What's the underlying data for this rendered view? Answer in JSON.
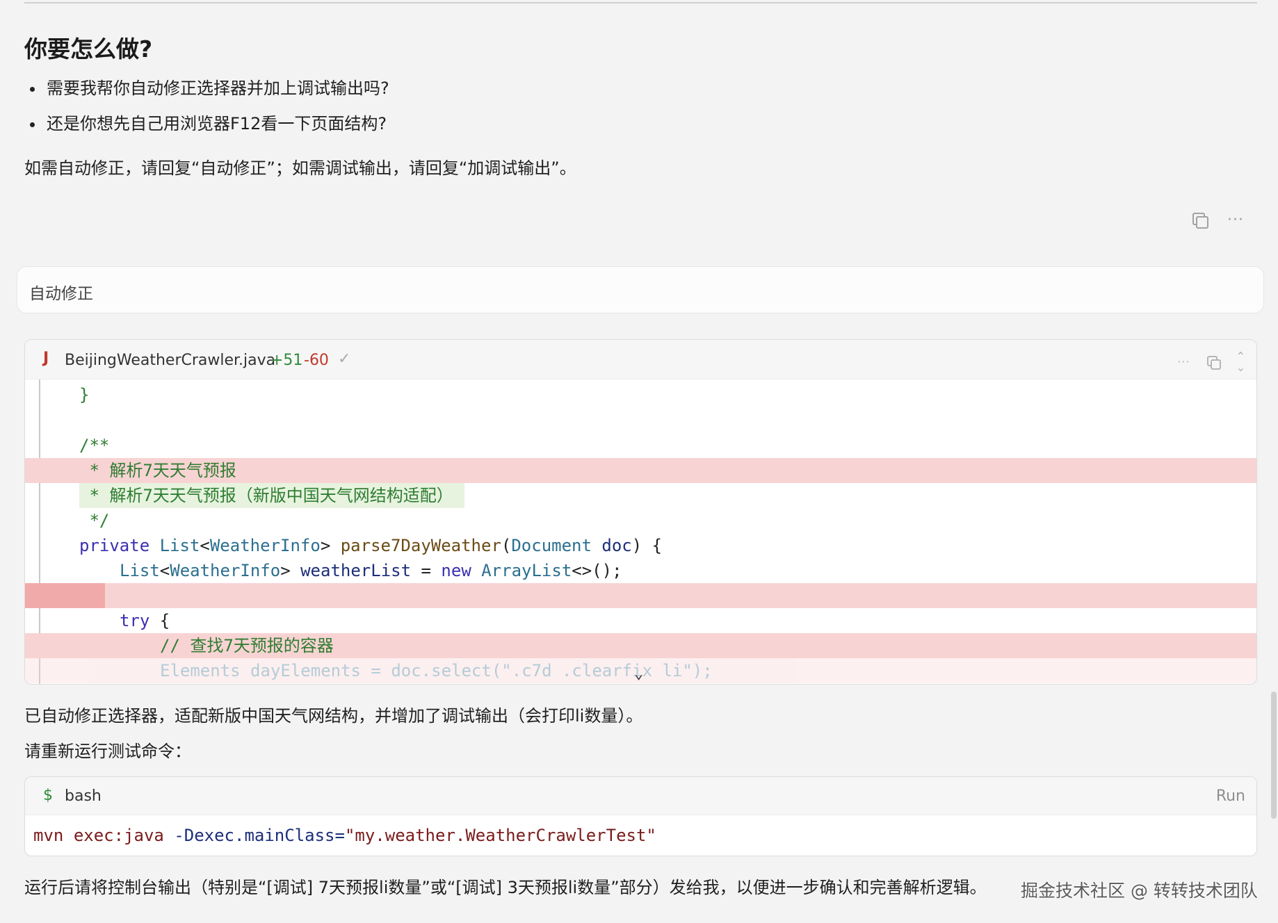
{
  "assistant_msg1": {
    "heading": "你要怎么做?",
    "bullets": [
      "需要我帮你自动修正选择器并加上调试输出吗?",
      "还是你想先自己用浏览器F12看一下页面结构?"
    ],
    "instruction": "如需自动修正，请回复“自动修正”；如需调试输出，请回复“加调试输出”。",
    "copy_icon": "copy-icon",
    "more_icon": "ellipsis-icon"
  },
  "user_msg": {
    "text": "自动修正"
  },
  "code_diff": {
    "file_icon": "J",
    "file_name": "BeijingWeatherCrawler.java",
    "additions": "+51",
    "deletions": "-60",
    "check": "✓",
    "lines": {
      "l1": "}",
      "l3": "/**",
      "l4": " * 解析7天天气预报",
      "l5": " * 解析7天天气预报（新版中国天气网结构适配）",
      "l6": " */",
      "l7_kw": "private",
      "l7_type": "List",
      "l7_generic": "WeatherInfo",
      "l7_fn": "parse7DayWeather",
      "l7_param_type": "Document",
      "l7_param": "doc",
      "l8_type": "List",
      "l8_generic": "WeatherInfo",
      "l8_var": "weatherList",
      "l8_new": "new",
      "l8_ctor": "ArrayList",
      "l10_kw": "try",
      "l11": "// 查找7天预报的容器",
      "l12": "Elements dayElements = doc.select(\".c7d .clearfix li\");"
    }
  },
  "assistant_msg2": {
    "summary": "已自动修正选择器，适配新版中国天气网结构，并增加了调试输出（会打印li数量）。",
    "prompt": "请重新运行测试命令："
  },
  "bash": {
    "symbol": "$",
    "label": "bash",
    "run": "Run",
    "cmd_tool": "mvn",
    "cmd_goal": "exec:java",
    "cmd_flag": "-Dexec.mainClass=",
    "cmd_value": "\"my.weather.WeatherCrawlerTest\""
  },
  "footer_text": "运行后请将控制台输出（特别是“[调试] 7天预报li数量”或“[调试] 3天预报li数量”部分）发给我，以便进一步确认和完善解析逻辑。",
  "watermark": "掘金技术社区 @ 转转技术团队"
}
